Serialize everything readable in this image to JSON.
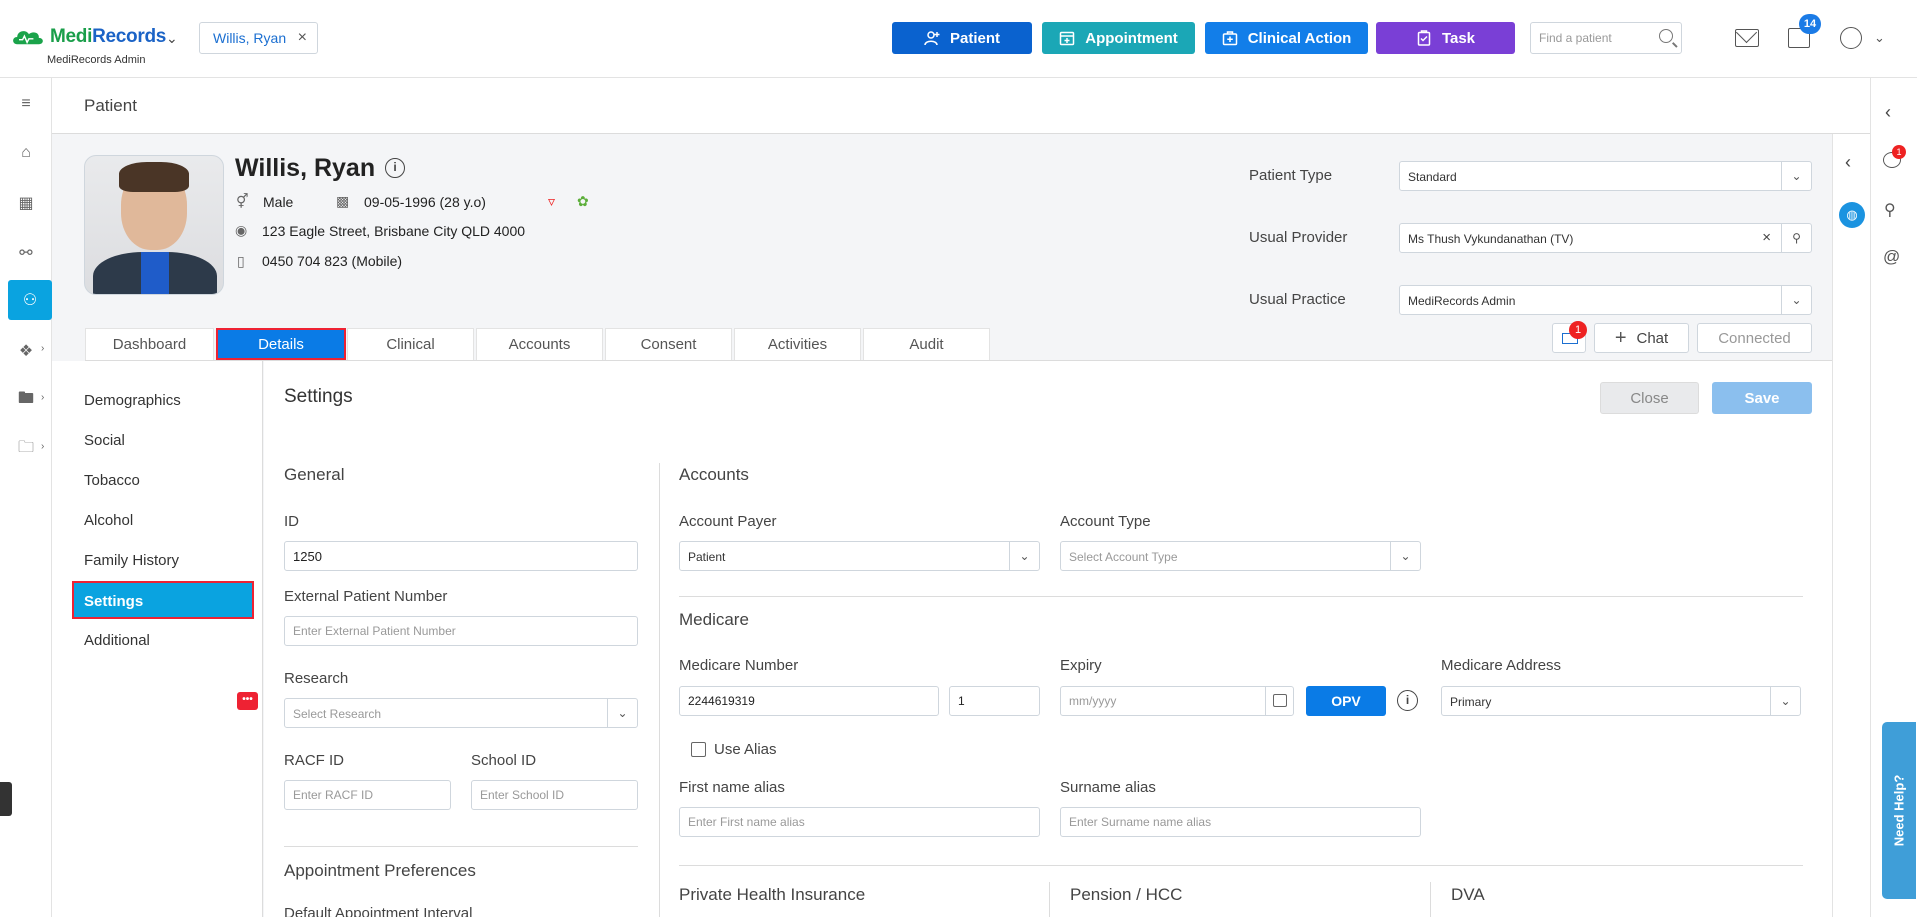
{
  "app": {
    "logo_part1": "Medi",
    "logo_part2": "Records",
    "logo_sub": "MediRecords Admin",
    "open_patient_tab": "Willis, Ryan"
  },
  "toolbar": {
    "patient": "Patient",
    "appointment": "Appointment",
    "clinical_action": "Clinical Action",
    "task": "Task",
    "find_placeholder": "Find a patient",
    "task_badge": "14"
  },
  "page": {
    "title": "Patient"
  },
  "patient": {
    "name": "Willis, Ryan",
    "gender": "Male",
    "dob": "09-05-1996 (28 y.o)",
    "address": "123 Eagle Street, Brisbane City QLD 4000",
    "phone": "0450 704 823 (Mobile)"
  },
  "patient_meta": {
    "patient_type_label": "Patient Type",
    "patient_type_value": "Standard",
    "usual_provider_label": "Usual Provider",
    "usual_provider_value": "Ms Thush Vykundanathan (TV)",
    "usual_practice_label": "Usual Practice",
    "usual_practice_value": "MediRecords Admin"
  },
  "tabs": [
    "Dashboard",
    "Details",
    "Clinical",
    "Accounts",
    "Consent",
    "Activities",
    "Audit"
  ],
  "actions": {
    "msg_badge": "1",
    "chat": "Chat",
    "connected": "Connected",
    "side_badge": "1"
  },
  "subnav": [
    "Demographics",
    "Social",
    "Tobacco",
    "Alcohol",
    "Family History",
    "Settings",
    "Additional"
  ],
  "settings": {
    "title": "Settings",
    "close": "Close",
    "save": "Save",
    "general": {
      "heading": "General",
      "id_label": "ID",
      "id_value": "1250",
      "ext_label": "External Patient Number",
      "ext_placeholder": "Enter External Patient Number",
      "research_label": "Research",
      "research_placeholder": "Select Research",
      "racf_label": "RACF ID",
      "racf_placeholder": "Enter RACF ID",
      "school_label": "School ID",
      "school_placeholder": "Enter School ID"
    },
    "appointment": {
      "heading": "Appointment Preferences",
      "default_interval_label": "Default Appointment Interval"
    },
    "accounts": {
      "heading": "Accounts",
      "payer_label": "Account Payer",
      "payer_value": "Patient",
      "type_label": "Account Type",
      "type_placeholder": "Select Account Type"
    },
    "medicare": {
      "heading": "Medicare",
      "number_label": "Medicare Number",
      "number_value": "2244619319",
      "irn_value": "1",
      "expiry_label": "Expiry",
      "expiry_placeholder": "mm/yyyy",
      "opv": "OPV",
      "address_label": "Medicare Address",
      "address_value": "Primary",
      "use_alias": "Use Alias",
      "first_alias_label": "First name alias",
      "first_alias_placeholder": "Enter First name alias",
      "surname_alias_label": "Surname alias",
      "surname_alias_placeholder": "Enter Surname name alias"
    },
    "bottom_sections": [
      "Private Health Insurance",
      "Pension / HCC",
      "DVA"
    ]
  },
  "help": {
    "label": "Need Help?"
  }
}
